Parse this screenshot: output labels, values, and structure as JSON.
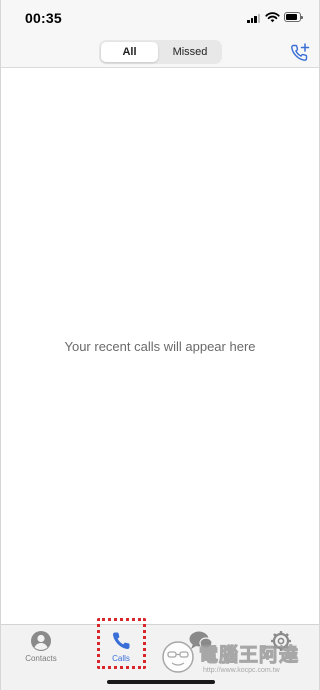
{
  "status_bar": {
    "time": "00:35",
    "icons": [
      "cellular-signal-icon",
      "wifi-icon",
      "battery-icon"
    ]
  },
  "header": {
    "segments": [
      {
        "label": "All",
        "selected": true
      },
      {
        "label": "Missed",
        "selected": false
      }
    ],
    "add_call_icon": "phone-plus-icon",
    "accent_color": "#3a6fd8"
  },
  "main": {
    "empty_message": "Your recent calls will appear here"
  },
  "tabbar": {
    "tabs": [
      {
        "label": "Contacts",
        "icon": "person-circle-icon",
        "active": false
      },
      {
        "label": "Calls",
        "icon": "phone-icon",
        "active": true
      },
      {
        "label": "",
        "icon": "chat-bubbles-icon",
        "active": false
      },
      {
        "label": "",
        "icon": "gear-icon",
        "active": false
      }
    ],
    "highlight_color": "#d8262a"
  },
  "watermark": {
    "text": "電腦王阿達",
    "url": "http://www.kocpc.com.tw"
  }
}
